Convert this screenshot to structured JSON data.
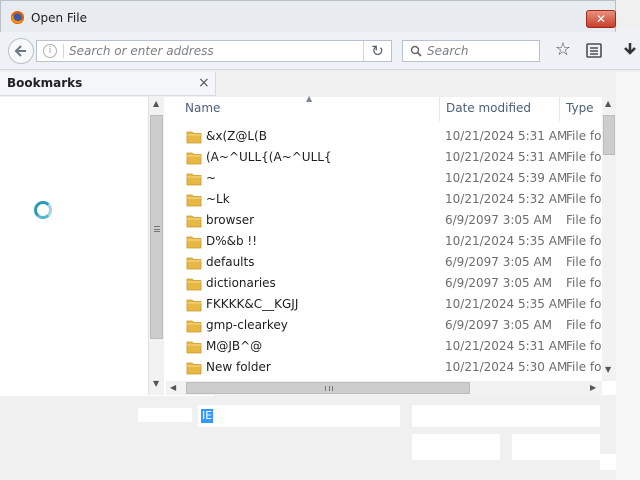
{
  "window": {
    "title": "Open File",
    "close_label": "✕"
  },
  "browser": {
    "address_placeholder": "Search or enter address",
    "search_placeholder": "Search"
  },
  "bookmarks": {
    "title": "Bookmarks",
    "close_label": "×"
  },
  "columns": {
    "name": "Name",
    "date": "Date modified",
    "type": "Type"
  },
  "files": [
    {
      "name": "&x(Z@L(B",
      "date": "10/21/2024 5:31 AM",
      "type": "File fol"
    },
    {
      "name": "(A~^ULL{(A~^ULL{",
      "date": "10/21/2024 5:31 AM",
      "type": "File fol"
    },
    {
      "name": "~",
      "date": "10/21/2024 5:39 AM",
      "type": "File fol"
    },
    {
      "name": "~Lk",
      "date": "10/21/2024 5:32 AM",
      "type": "File fol"
    },
    {
      "name": "browser",
      "date": "6/9/2097 3:05 AM",
      "type": "File fol"
    },
    {
      "name": "D%&b !!",
      "date": "10/21/2024 5:35 AM",
      "type": "File fol"
    },
    {
      "name": "defaults",
      "date": "6/9/2097 3:05 AM",
      "type": "File fol"
    },
    {
      "name": "dictionaries",
      "date": "6/9/2097 3:05 AM",
      "type": "File fol"
    },
    {
      "name": "FKKKK&C__KGJJ",
      "date": "10/21/2024 5:35 AM",
      "type": "File fol"
    },
    {
      "name": "gmp-clearkey",
      "date": "6/9/2097 3:05 AM",
      "type": "File fol"
    },
    {
      "name": "M@JB^@",
      "date": "10/21/2024 5:31 AM",
      "type": "File fol"
    },
    {
      "name": "New folder",
      "date": "10/21/2024 5:30 AM",
      "type": "File fol"
    }
  ],
  "filename": {
    "value": "IE"
  },
  "icons": {
    "app": "firefox-icon",
    "folder": "folder-icon",
    "folder_color": "#e8b845"
  }
}
